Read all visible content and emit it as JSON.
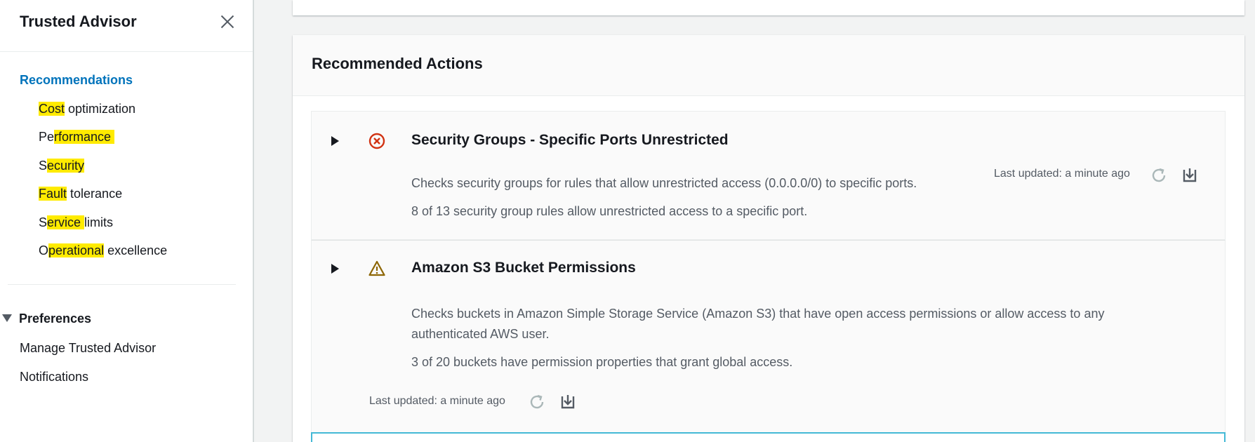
{
  "sidebar": {
    "title": "Trusted Advisor",
    "section_label": "Recommendations",
    "categories": [
      {
        "pre": "",
        "hl": "Cost",
        "post": " optimization"
      },
      {
        "pre": "Pe",
        "hl": "rformance ",
        "post": ""
      },
      {
        "pre": "S",
        "hl": "ecurity",
        "post": ""
      },
      {
        "pre": "",
        "hl": "Fault",
        "post": " tolerance"
      },
      {
        "pre": "S",
        "hl": "ervice ",
        "post": "limits"
      },
      {
        "pre": "O",
        "hl": "perational",
        "post": " excellence"
      }
    ],
    "preferences_label": "Preferences",
    "links": [
      "Manage Trusted Advisor",
      "Notifications"
    ]
  },
  "main": {
    "panel_title": "Recommended Actions",
    "checks": [
      {
        "title": "Security Groups - Specific Ports Unrestricted",
        "status_icon": "error-icon",
        "description": "Checks security groups for rules that allow unrestricted access (0.0.0.0/0) to specific ports.",
        "summary": "8 of 13 security group rules allow unrestricted access to a specific port.",
        "last_updated": "Last updated: a minute ago"
      },
      {
        "title": "Amazon S3 Bucket Permissions",
        "status_icon": "warning-icon",
        "description": "Checks buckets in Amazon Simple Storage Service (Amazon S3) that have open access permissions or allow access to any authenticated AWS user.",
        "summary": "3 of 20 buckets have permission properties that grant global access.",
        "last_updated": "Last updated: a minute ago"
      }
    ]
  },
  "colors": {
    "link": "#0073bb",
    "highlight": "#ffeb00",
    "error": "#d13212",
    "warning": "#8d6605",
    "focus_border": "#44b9d6"
  }
}
